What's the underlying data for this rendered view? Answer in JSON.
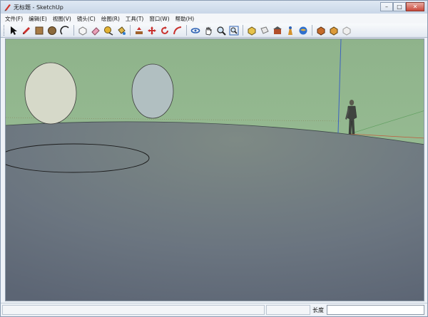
{
  "window": {
    "title": "无标题 - SketchUp",
    "controls": {
      "minimize": "–",
      "maximize": "□",
      "close": "✕"
    }
  },
  "menubar": {
    "items": [
      {
        "label": "文件(F)"
      },
      {
        "label": "编辑(E)"
      },
      {
        "label": "视图(V)"
      },
      {
        "label": "镜头(C)"
      },
      {
        "label": "绘图(R)"
      },
      {
        "label": "工具(T)"
      },
      {
        "label": "窗口(W)"
      },
      {
        "label": "帮助(H)"
      }
    ]
  },
  "toolbar": {
    "groups": [
      [
        "select-icon",
        "pencil-icon",
        "rectangle-icon",
        "circle-icon",
        "arc-icon"
      ],
      [
        "make-component-icon",
        "eraser-icon",
        "tape-measure-icon",
        "paint-bucket-icon"
      ],
      [
        "push-pull-icon",
        "move-icon",
        "rotate-icon",
        "follow-me-icon"
      ],
      [
        "orbit-icon",
        "pan-icon",
        "zoom-icon",
        "zoom-extents-icon"
      ],
      [
        "iso-view-icon",
        "top-view-icon",
        "3d-warehouse-icon",
        "share-model-icon",
        "google-earth-icon"
      ],
      [
        "component-get-icon",
        "component-share-icon",
        "extension-icon"
      ]
    ]
  },
  "statusbar": {
    "measurement_label": "长度",
    "measurement_value": ""
  }
}
